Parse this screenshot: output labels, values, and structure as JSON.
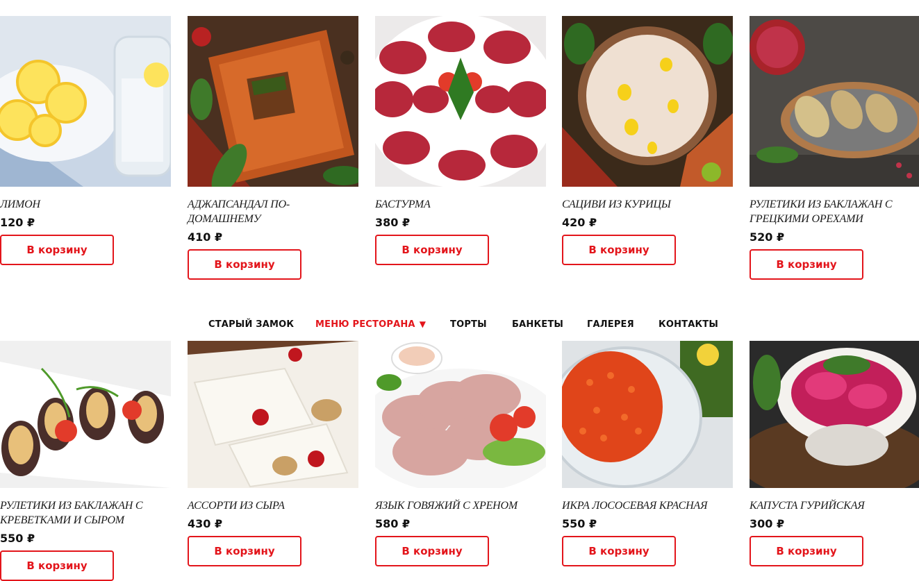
{
  "nav": {
    "items": [
      {
        "label": "СТАРЫЙ ЗАМОК"
      },
      {
        "label": "МЕНЮ РЕСТОРАНА",
        "caret": "▼"
      },
      {
        "label": "ТОРТЫ"
      },
      {
        "label": "БАНКЕТЫ"
      },
      {
        "label": "ГАЛЕРЕЯ"
      },
      {
        "label": "КОНТАКТЫ"
      }
    ]
  },
  "products_row1": [
    {
      "name": "ЛИМОН",
      "price": "120 ₽",
      "button": "В корзину"
    },
    {
      "name": "АДЖАПСАНДАЛ ПО-ДОМАШНЕМУ",
      "price": "410 ₽",
      "button": "В корзину"
    },
    {
      "name": "БАСТУРМА",
      "price": "380 ₽",
      "button": "В корзину"
    },
    {
      "name": "САЦИВИ ИЗ КУРИЦЫ",
      "price": "420 ₽",
      "button": "В корзину"
    },
    {
      "name": "РУЛЕТИКИ ИЗ БАКЛАЖАН С ГРЕЦКИМИ ОРЕХАМИ",
      "price": "520 ₽",
      "button": "В корзину"
    }
  ],
  "products_row2": [
    {
      "name": "РУЛЕТИКИ ИЗ БАКЛАЖАН С КРЕВЕТКАМИ И СЫРОМ",
      "price": "550 ₽",
      "button": "В корзину"
    },
    {
      "name": "АССОРТИ ИЗ СЫРА",
      "price": "430 ₽",
      "button": "В корзину"
    },
    {
      "name": "ЯЗЫК ГОВЯЖИЙ С ХРЕНОМ",
      "price": "580 ₽",
      "button": "В корзину"
    },
    {
      "name": "ИКРА ЛОСОСЕВАЯ КРАСНАЯ",
      "price": "550 ₽",
      "button": "В корзину"
    },
    {
      "name": "КАПУСТА ГУРИЙСКАЯ",
      "price": "300 ₽",
      "button": "В корзину"
    }
  ],
  "colors": {
    "accent": "#e3151b",
    "text": "#111111"
  }
}
